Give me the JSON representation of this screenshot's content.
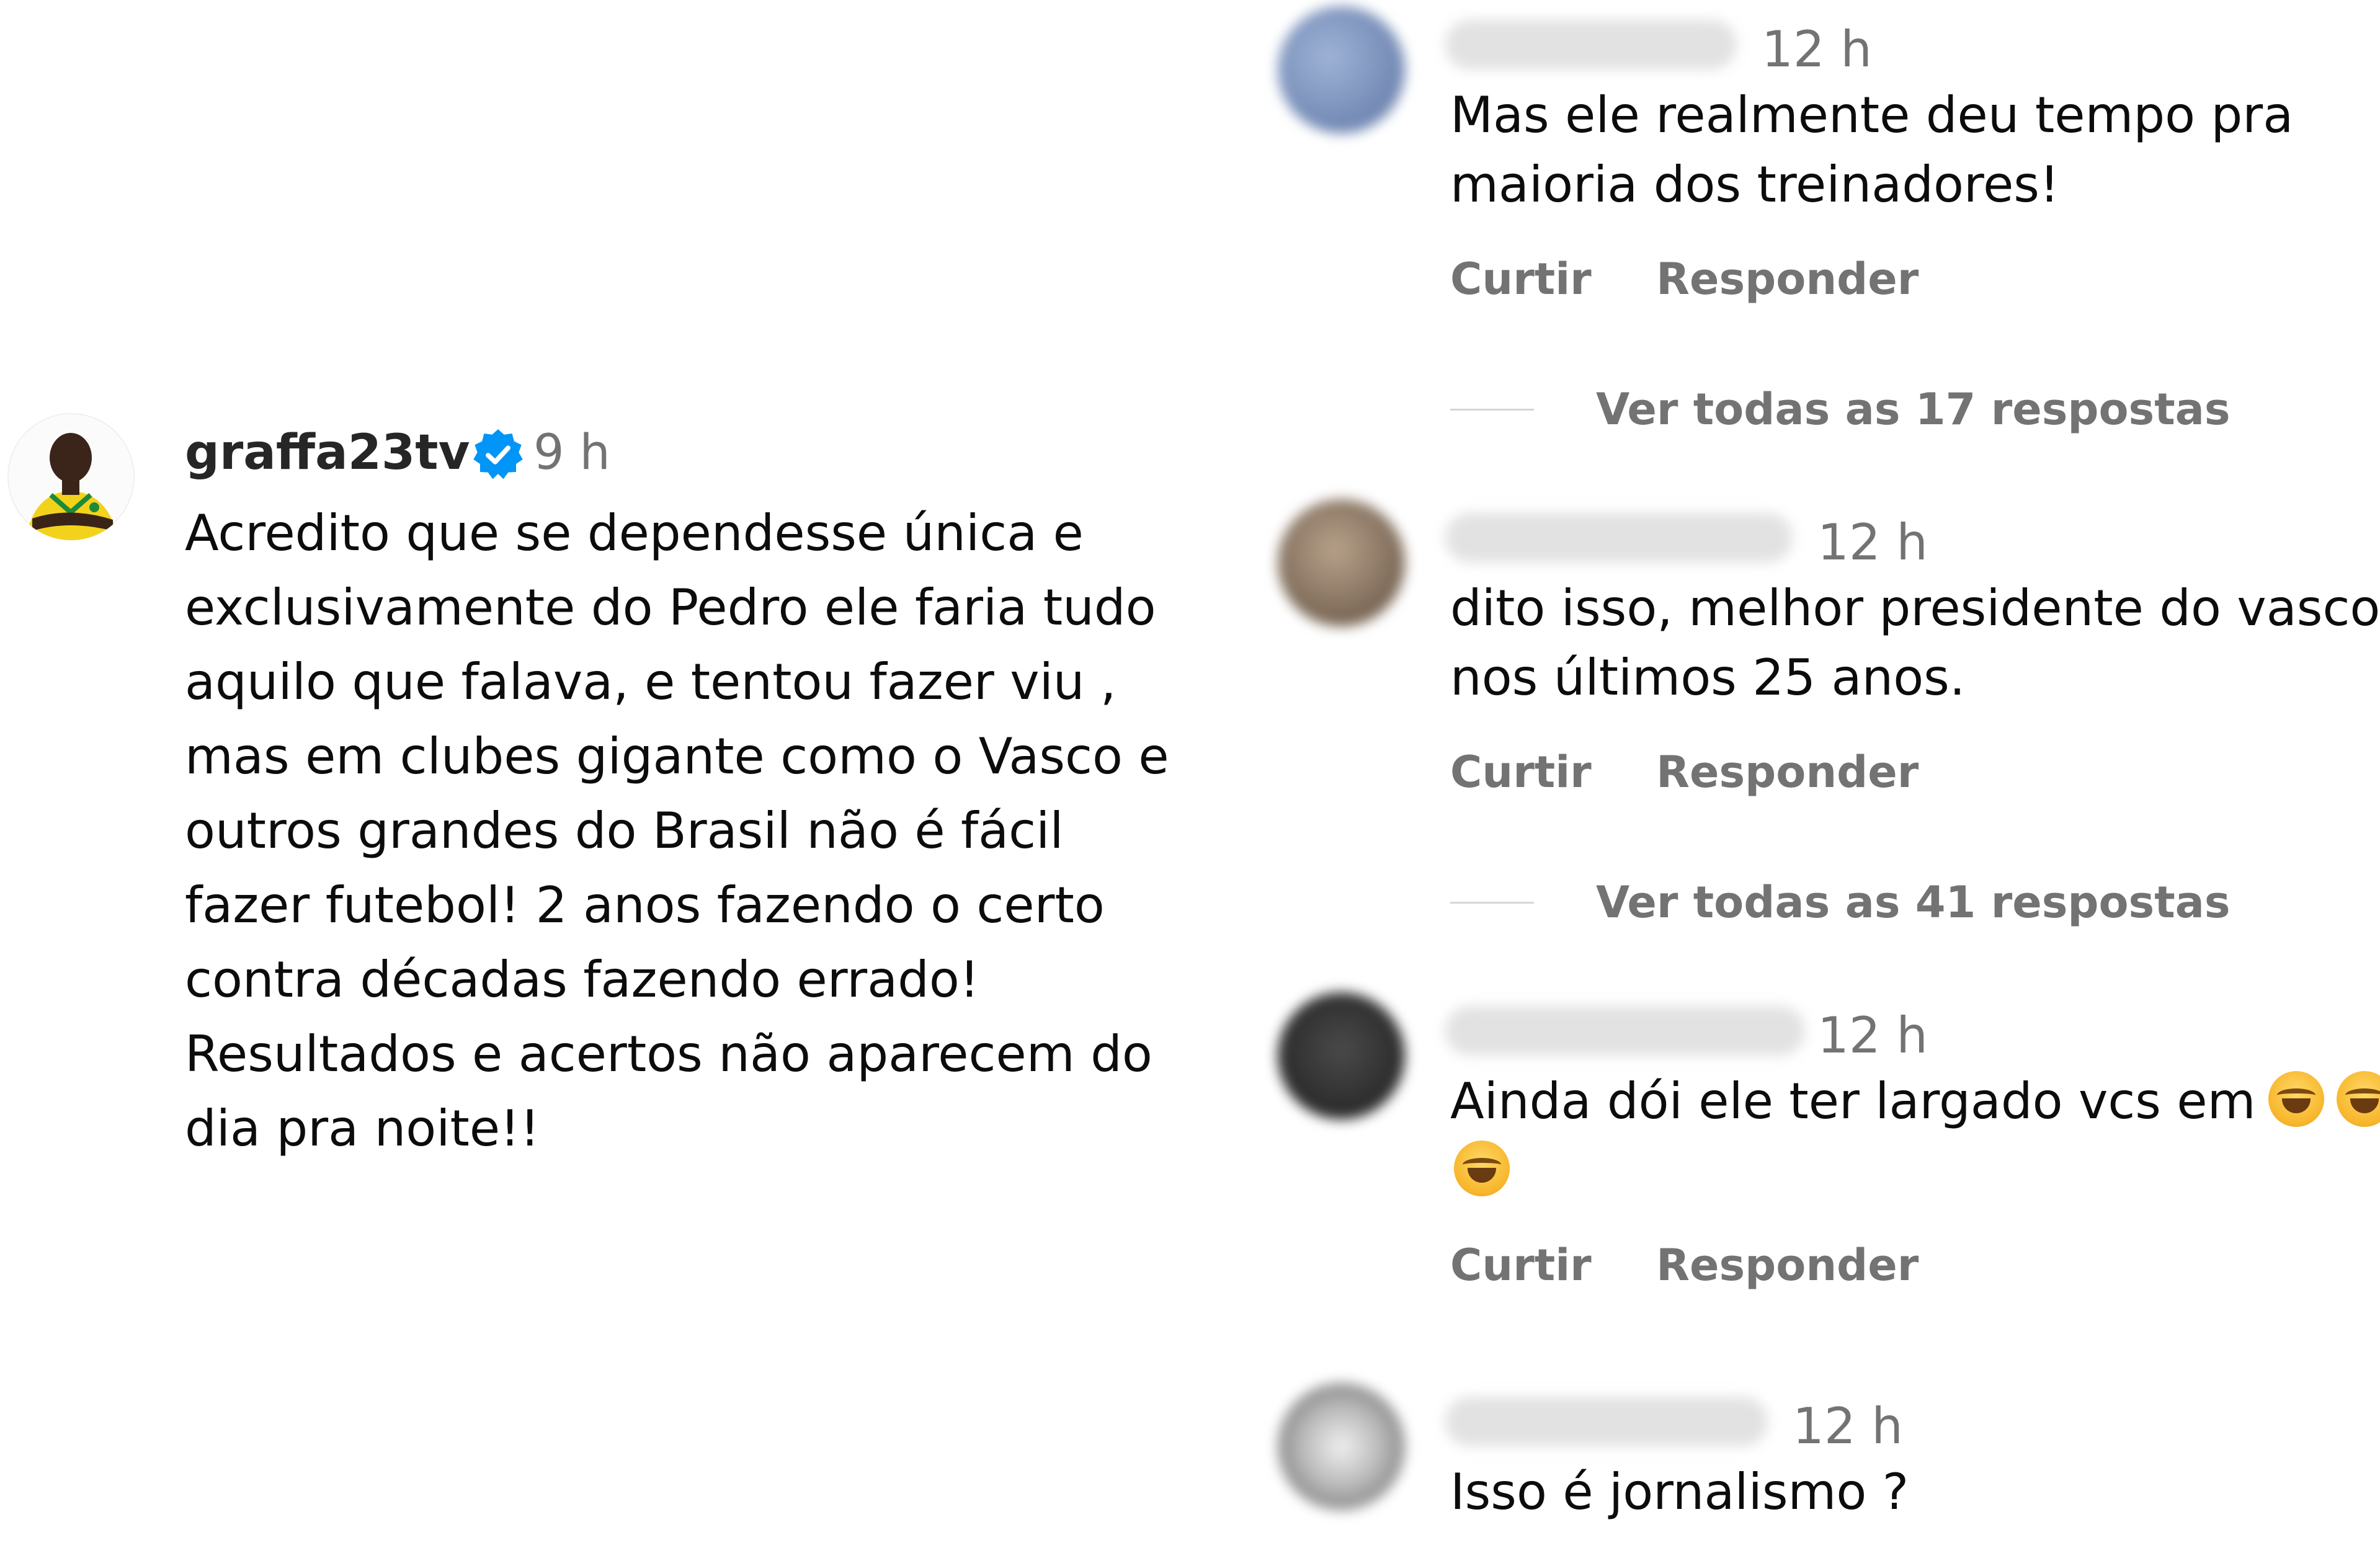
{
  "main_comment": {
    "username": "graffa23tv",
    "verified": true,
    "time": "9 h",
    "lines": [
      "Acredito que se dependesse única e",
      "exclusivamente do Pedro ele faria tudo",
      "aquilo que falava, e tentou fazer viu ,",
      "mas em clubes gigante como o Vasco e",
      "outros grandes do Brasil não é fácil",
      "fazer futebol! 2 anos fazendo o certo",
      "contra décadas fazendo errado!",
      "Resultados e acertos não aparecem do",
      "dia pra noite!!"
    ],
    "avatar_icon": "user-avatar-yellow-jersey"
  },
  "replies": [
    {
      "time": "12 h",
      "lines": [
        "Mas ele realmente deu tempo pra",
        "maioria dos treinadores!"
      ],
      "like_label": "Curtir",
      "reply_label": "Responder",
      "view_all": "Ver todas as 17 respostas",
      "avatar_color": "#7c94bb"
    },
    {
      "time": "12 h",
      "lines": [
        "dito isso, melhor presidente do vasco",
        "nos últimos 25 anos."
      ],
      "like_label": "Curtir",
      "reply_label": "Responder",
      "view_all": "Ver todas as 41 respostas",
      "avatar_color": "#8a7a6a"
    },
    {
      "time": "12 h",
      "line1": "Ainda dói ele ter largado vcs em",
      "like_label": "Curtir",
      "reply_label": "Responder",
      "avatar_color": "#3a3a3a",
      "emoji": "face-with-tears-of-joy"
    },
    {
      "time": "12 h",
      "lines": [
        "Isso é jornalismo ?"
      ],
      "avatar_color": "#9a9a9a"
    }
  ],
  "colors": {
    "verified_blue": "#0095f6",
    "secondary_text": "#737373",
    "primary_text": "#0c0c0c"
  }
}
